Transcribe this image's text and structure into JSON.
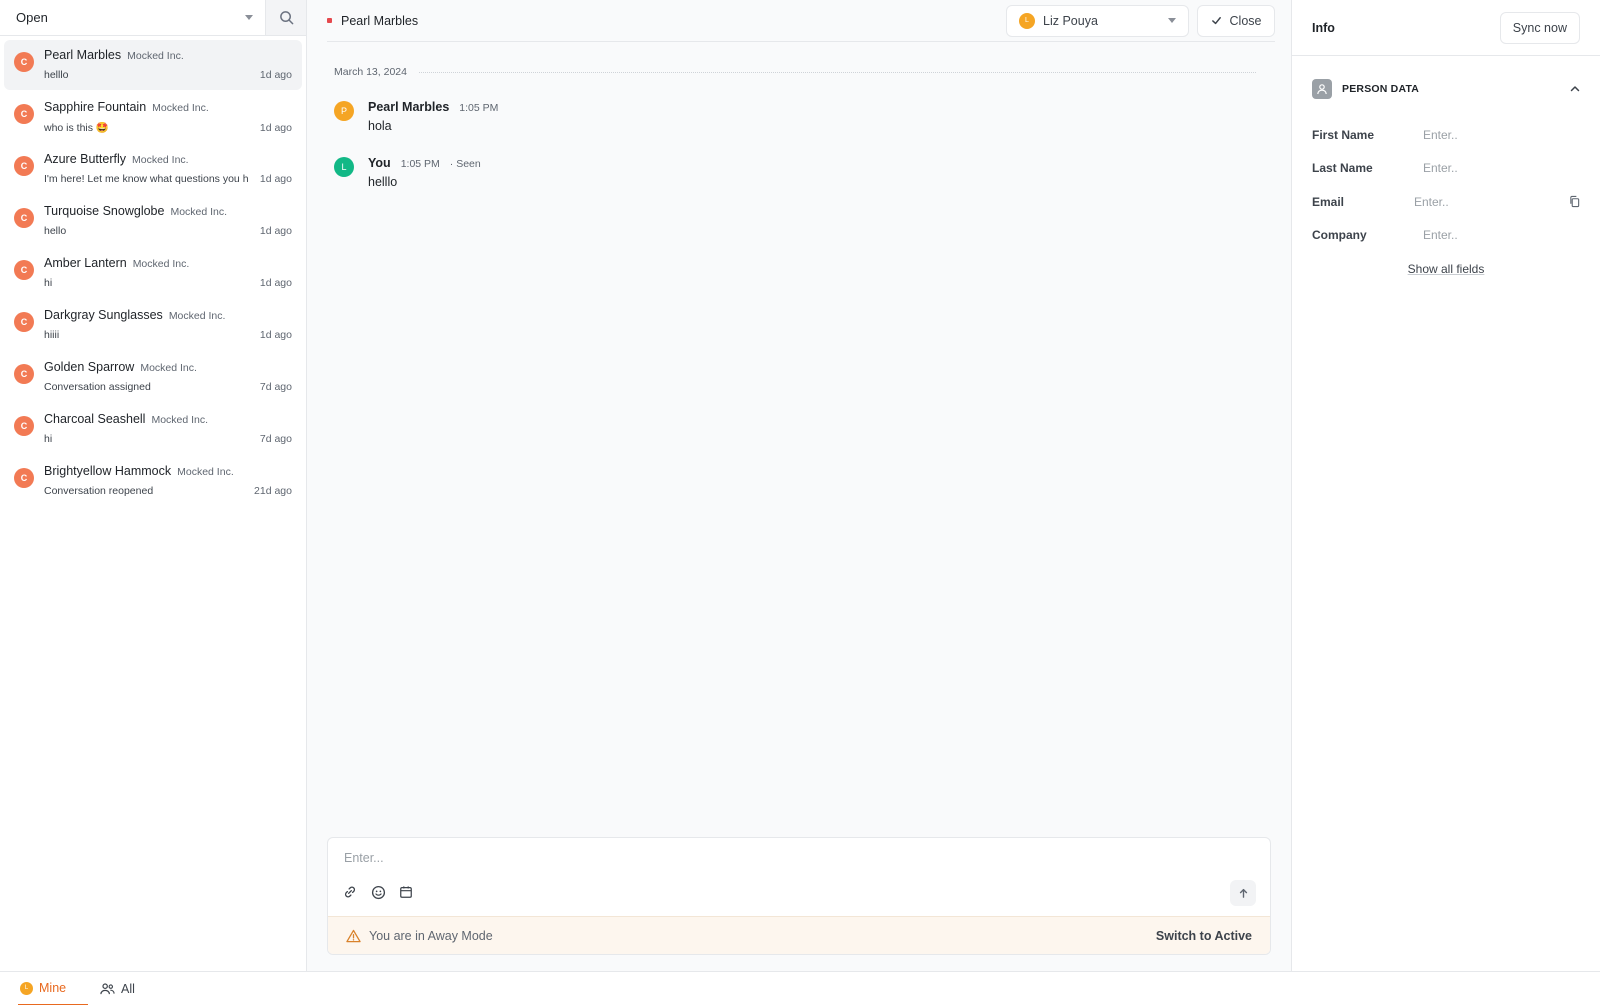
{
  "sidebar": {
    "status_filter": "Open",
    "conversations": [
      {
        "avatar": "C",
        "name": "Pearl Marbles",
        "company": "Mocked Inc.",
        "preview": "helllo",
        "time": "1d ago"
      },
      {
        "avatar": "C",
        "name": "Sapphire Fountain",
        "company": "Mocked Inc.",
        "preview": "who is this 🤩",
        "time": "1d ago"
      },
      {
        "avatar": "C",
        "name": "Azure Butterfly",
        "company": "Mocked Inc.",
        "preview": "I'm here! Let me know what questions you h",
        "time": "1d ago"
      },
      {
        "avatar": "C",
        "name": "Turquoise Snowglobe",
        "company": "Mocked Inc.",
        "preview": "hello",
        "time": "1d ago"
      },
      {
        "avatar": "C",
        "name": "Amber Lantern",
        "company": "Mocked Inc.",
        "preview": "hi",
        "time": "1d ago"
      },
      {
        "avatar": "C",
        "name": "Darkgray Sunglasses",
        "company": "Mocked Inc.",
        "preview": "hiiii",
        "time": "1d ago"
      },
      {
        "avatar": "C",
        "name": "Golden Sparrow",
        "company": "Mocked Inc.",
        "preview": "Conversation assigned",
        "time": "7d ago"
      },
      {
        "avatar": "C",
        "name": "Charcoal Seashell",
        "company": "Mocked Inc.",
        "preview": "hi",
        "time": "7d ago"
      },
      {
        "avatar": "C",
        "name": "Brightyellow Hammock",
        "company": "Mocked Inc.",
        "preview": "Conversation reopened",
        "time": "21d ago"
      }
    ]
  },
  "conversation": {
    "title": "Pearl Marbles",
    "assignee": {
      "avatar": "L",
      "name": "Liz Pouya"
    },
    "close_label": "Close",
    "date": "March 13, 2024",
    "messages": [
      {
        "avatar": "P",
        "avatar_color": "#f5a524",
        "author": "Pearl Marbles",
        "time": "1:05 PM",
        "status": "",
        "text": "hola"
      },
      {
        "avatar": "L",
        "avatar_color": "#12b886",
        "author": "You",
        "time": "1:05 PM",
        "status": "· Seen",
        "text": "helllo"
      }
    ]
  },
  "composer": {
    "placeholder": "Enter...",
    "away_text": "You are in Away Mode",
    "switch_label": "Switch to Active"
  },
  "info": {
    "title": "Info",
    "sync_label": "Sync now",
    "section_title": "PERSON DATA",
    "fields": [
      {
        "label": "First Name",
        "placeholder": "Enter.."
      },
      {
        "label": "Last Name",
        "placeholder": "Enter.."
      },
      {
        "label": "Email",
        "placeholder": "Enter.."
      },
      {
        "label": "Company",
        "placeholder": "Enter.."
      }
    ],
    "show_all_label": "Show all fields"
  },
  "bottom_tabs": {
    "mine_avatar": "L",
    "mine_label": "Mine",
    "all_label": "All"
  },
  "colors": {
    "accent": "#e8691f",
    "contact_avatar": "#f27a54",
    "unread_dot": "#e5484d",
    "away_banner": "#fdf6ee"
  }
}
